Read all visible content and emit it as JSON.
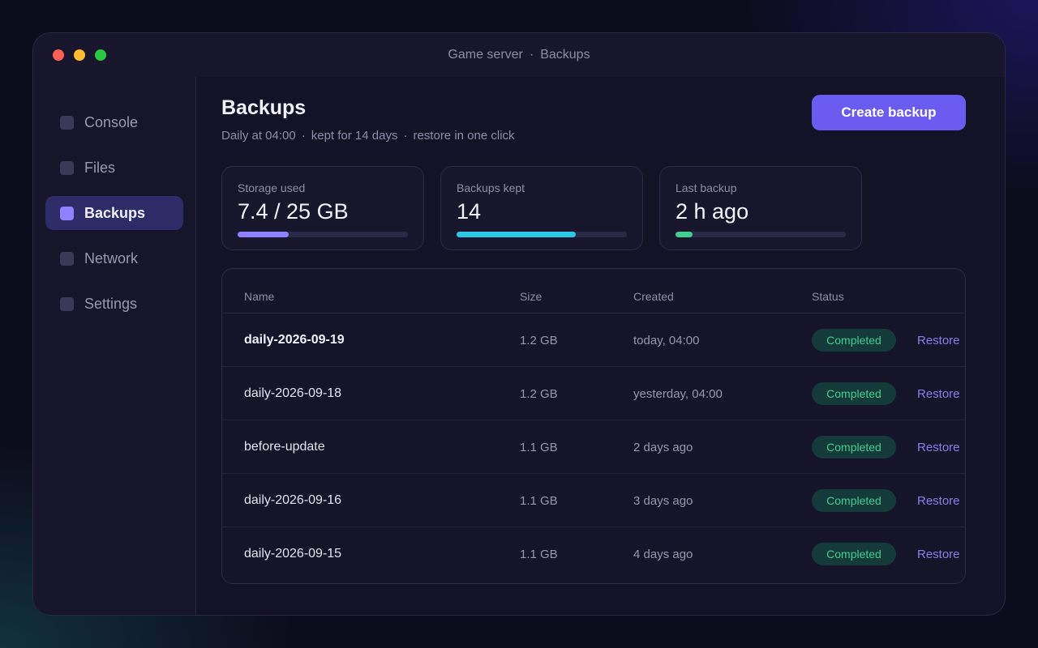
{
  "window": {
    "title_app": "Game server",
    "title_separator": "·",
    "title_section": "Backups"
  },
  "sidebar": {
    "items": [
      {
        "label": "Console",
        "icon": "console-icon",
        "active": false
      },
      {
        "label": "Files",
        "icon": "files-icon",
        "active": false
      },
      {
        "label": "Backups",
        "icon": "backups-icon",
        "active": true
      },
      {
        "label": "Network",
        "icon": "network-icon",
        "active": false
      },
      {
        "label": "Settings",
        "icon": "settings-icon",
        "active": false
      }
    ]
  },
  "header": {
    "title": "Backups",
    "schedule": "Daily at 04:00",
    "retention": "kept for 14 days",
    "restore_note": "restore in one click",
    "separator": "·",
    "create_label": "Create backup"
  },
  "stats": [
    {
      "label": "Storage used",
      "value": "7.4 / 25 GB",
      "progress": 0.3,
      "color": "#8f82ff"
    },
    {
      "label": "Backups kept",
      "value": "14",
      "progress": 0.7,
      "color": "#2ec8e6"
    },
    {
      "label": "Last backup",
      "value": "2 h ago",
      "progress": 0.1,
      "color": "#3fcf8e"
    }
  ],
  "table": {
    "columns": [
      "Name",
      "Size",
      "Created",
      "Status"
    ],
    "action_label": "Restore",
    "rows": [
      {
        "name": "daily-2026-09-19",
        "size": "1.2 GB",
        "created": "today, 04:00",
        "status": "Completed"
      },
      {
        "name": "daily-2026-09-18",
        "size": "1.2 GB",
        "created": "yesterday, 04:00",
        "status": "Completed"
      },
      {
        "name": "before-update",
        "size": "1.1 GB",
        "created": "2 days ago",
        "status": "Completed"
      },
      {
        "name": "daily-2026-09-16",
        "size": "1.1 GB",
        "created": "3 days ago",
        "status": "Completed"
      },
      {
        "name": "daily-2026-09-15",
        "size": "1.1 GB",
        "created": "4 days ago",
        "status": "Completed"
      }
    ]
  },
  "colors": {
    "accent": "#6a5cf0",
    "status_completed": "#3fcf8e"
  }
}
